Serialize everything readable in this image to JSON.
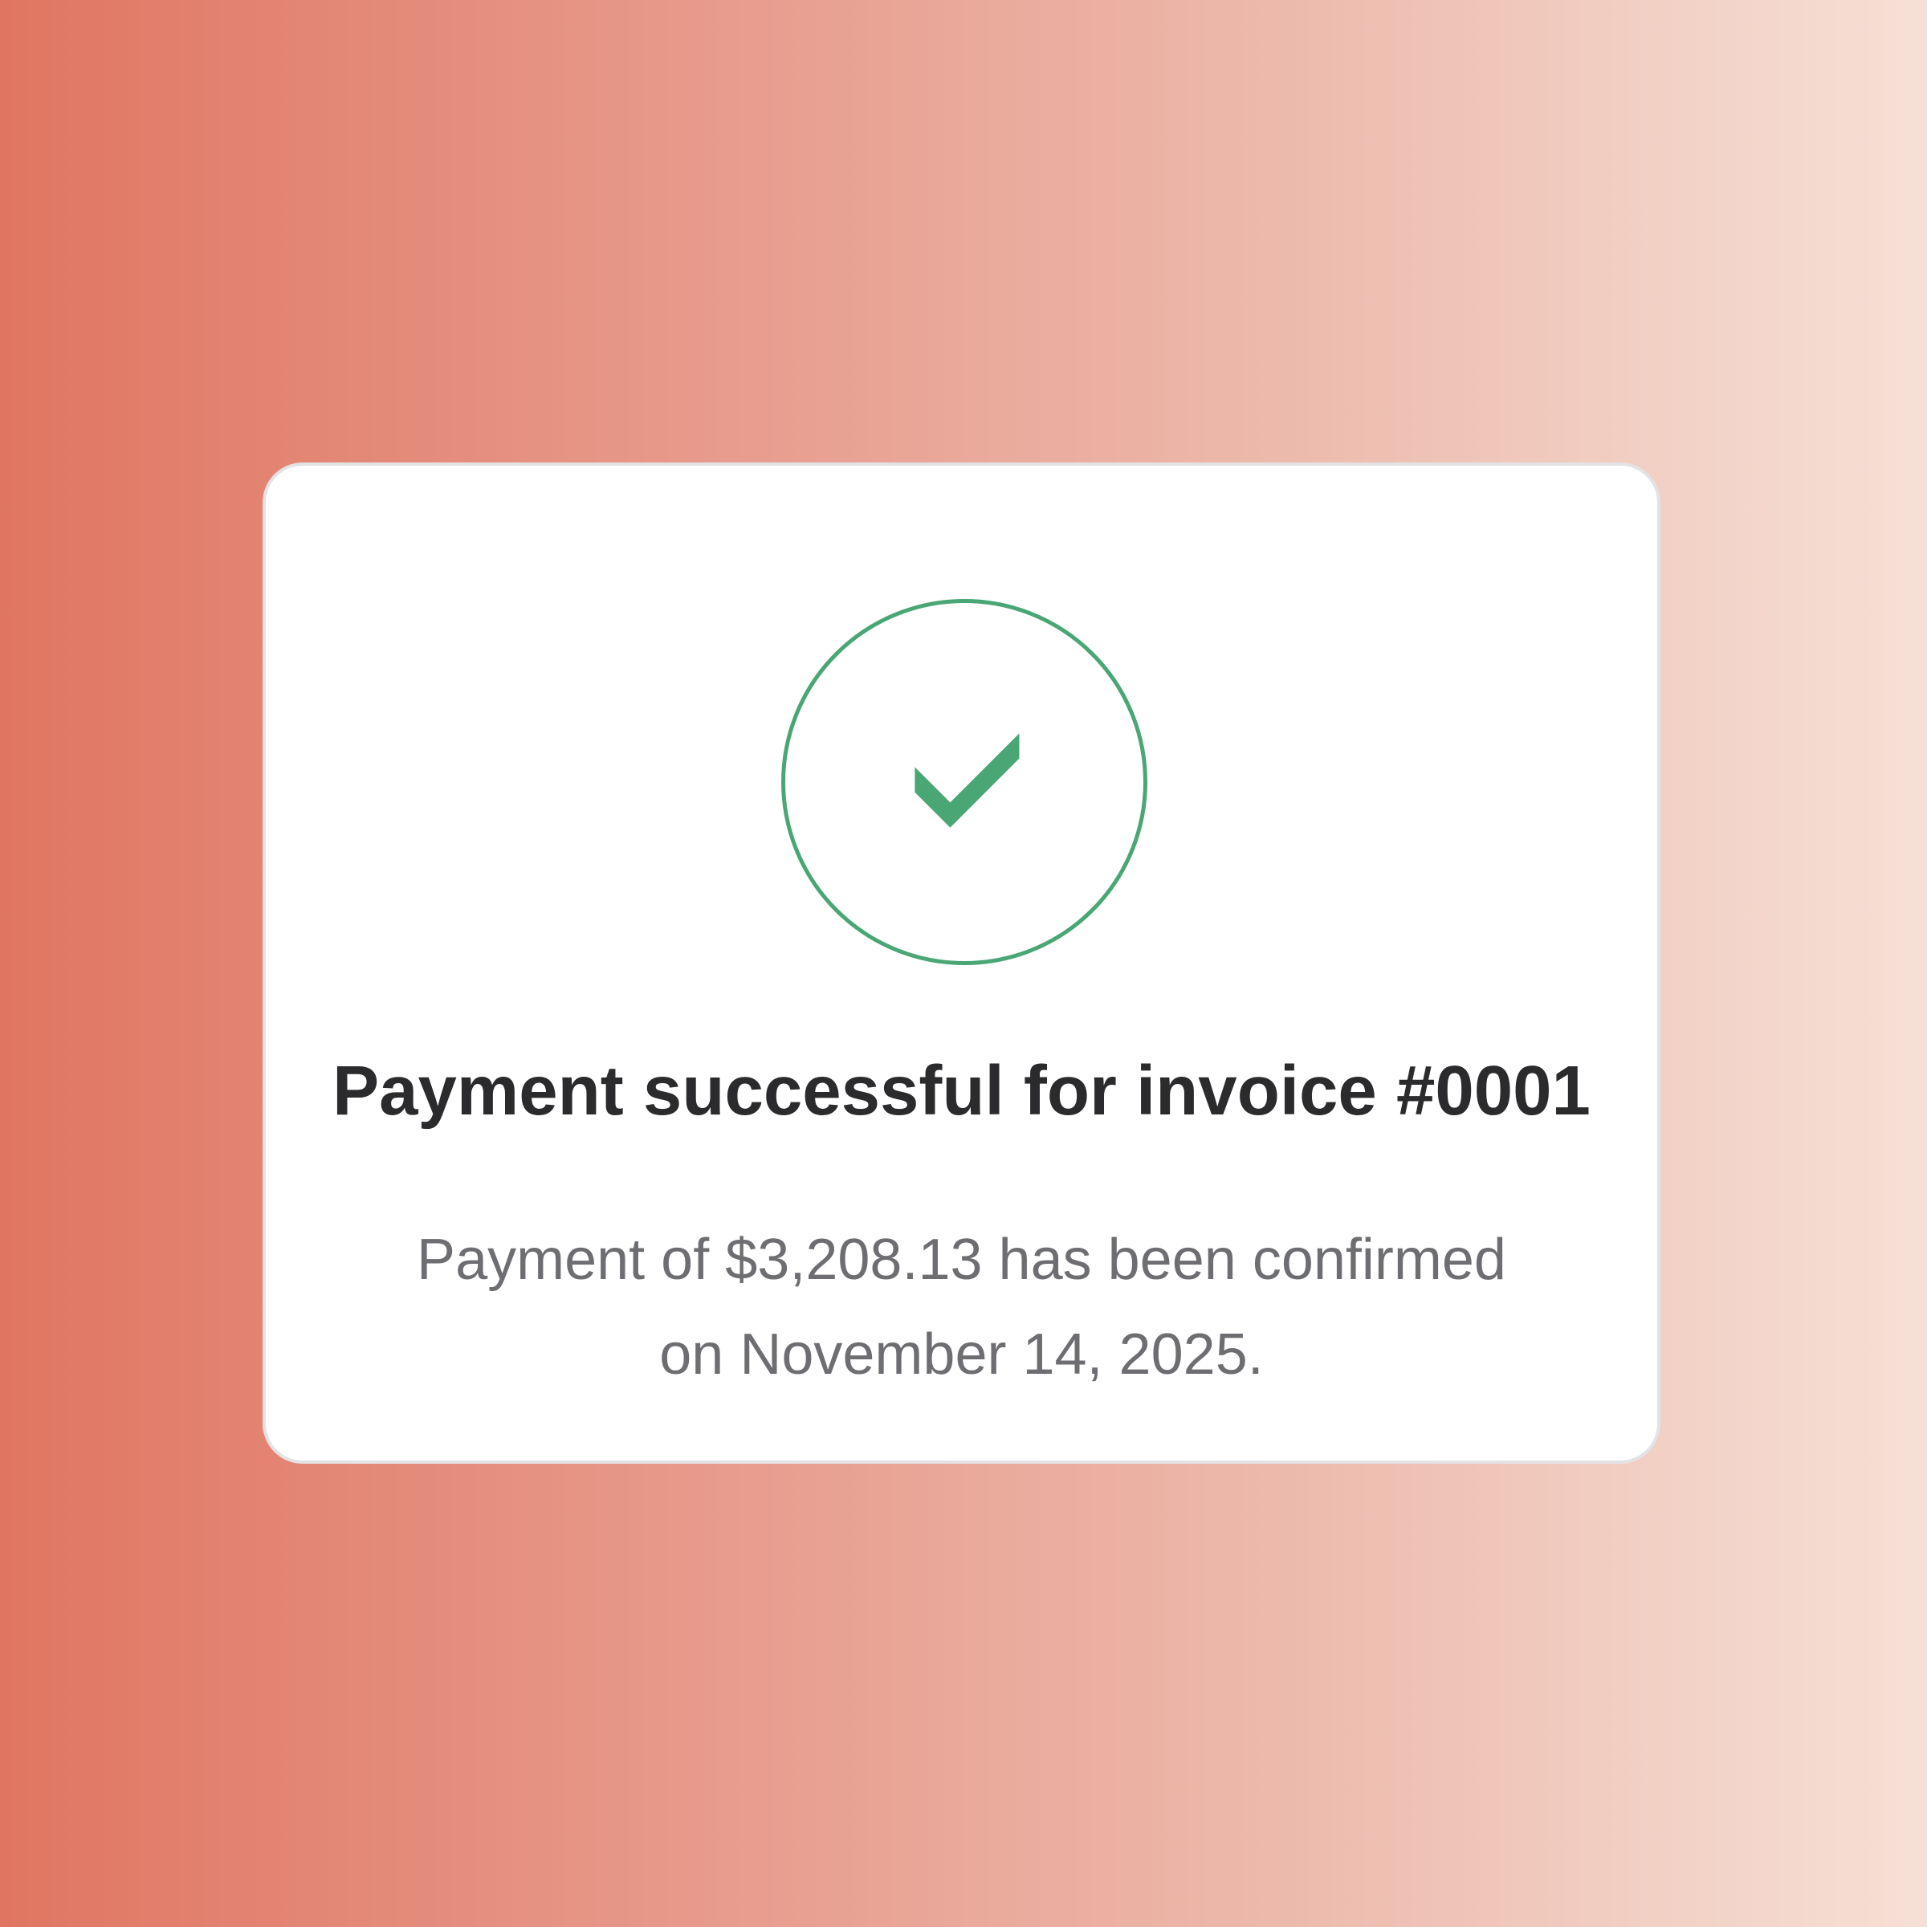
{
  "background": {
    "gradient_start": "#e07662",
    "gradient_end": "#f6e0d6"
  },
  "dialog": {
    "icon": "check-circle-icon",
    "accent_color": "#4aa675",
    "title": "Payment successful for invoice #0001",
    "message_line_1": "Payment of $3,208.13 has been confirmed",
    "message_line_2": "on November 14, 2025."
  }
}
